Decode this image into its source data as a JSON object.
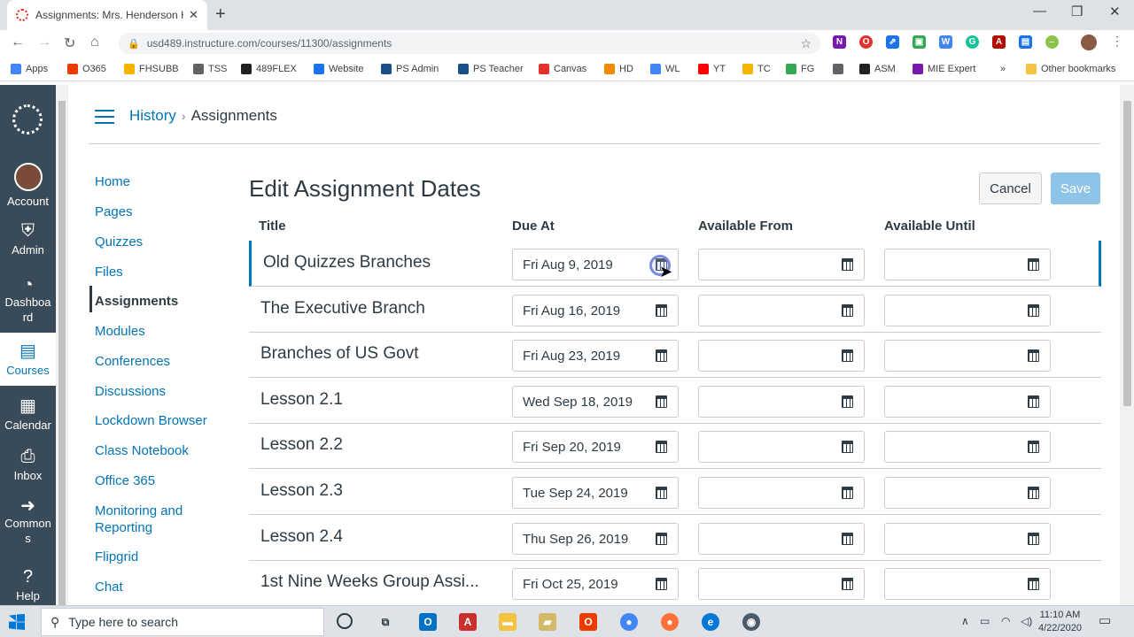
{
  "browser": {
    "tab_title": "Assignments: Mrs. Henderson Hi",
    "url": "usd489.instructure.com/courses/11300/assignments",
    "bookmarks": [
      {
        "label": "Apps",
        "color": "#4285f4"
      },
      {
        "label": "O365",
        "color": "#eb3c00"
      },
      {
        "label": "FHSUBB",
        "color": "#f4b400"
      },
      {
        "label": "TSS",
        "color": "#5f6368"
      },
      {
        "label": "489FLEX",
        "color": "#202124"
      },
      {
        "label": "Website",
        "color": "#1a73e8"
      },
      {
        "label": "PS Admin",
        "color": "#1b4f8a"
      },
      {
        "label": "PS Teacher",
        "color": "#1b4f8a"
      },
      {
        "label": "Canvas",
        "color": "#e3322b"
      },
      {
        "label": "HD",
        "color": "#f28b00"
      },
      {
        "label": "WL",
        "color": "#4285f4"
      },
      {
        "label": "YT",
        "color": "#ff0000"
      },
      {
        "label": "TC",
        "color": "#f4b400"
      },
      {
        "label": "FG",
        "color": "#34a853"
      },
      {
        "label": "",
        "color": "#5f6368"
      },
      {
        "label": "ASM",
        "color": "#202124"
      },
      {
        "label": "MIE Expert",
        "color": "#7719aa"
      }
    ],
    "more_bookmarks": "»",
    "other_bookmarks": "Other bookmarks"
  },
  "global_nav": [
    {
      "label": "Account",
      "icon": "avatar"
    },
    {
      "label": "Admin",
      "icon": "shield-icon"
    },
    {
      "label": "Dashboa rd",
      "icon": "dashboard-icon"
    },
    {
      "label": "Courses",
      "icon": "courses-icon"
    },
    {
      "label": "Calendar",
      "icon": "calendar-icon"
    },
    {
      "label": "Inbox",
      "icon": "inbox-icon"
    },
    {
      "label": "Common s",
      "icon": "commons-icon"
    },
    {
      "label": "Help",
      "icon": "help-icon"
    }
  ],
  "breadcrumb": {
    "course": "History",
    "page": "Assignments"
  },
  "course_nav": [
    "Home",
    "Pages",
    "Quizzes",
    "Files",
    "Assignments",
    "Modules",
    "Conferences",
    "Discussions",
    "Lockdown Browser",
    "Class Notebook",
    "Office 365",
    "Monitoring and Reporting",
    "Flipgrid",
    "Chat"
  ],
  "course_nav_active": "Assignments",
  "main": {
    "title": "Edit Assignment Dates",
    "cancel_label": "Cancel",
    "save_label": "Save",
    "columns": [
      "Title",
      "Due At",
      "Available From",
      "Available Until"
    ],
    "rows": [
      {
        "title": "Old Quizzes Branches",
        "due": "Fri Aug 9, 2019",
        "from": "",
        "until": ""
      },
      {
        "title": "The Executive Branch",
        "due": "Fri Aug 16, 2019",
        "from": "",
        "until": ""
      },
      {
        "title": "Branches of US Govt",
        "due": "Fri Aug 23, 2019",
        "from": "",
        "until": ""
      },
      {
        "title": "Lesson 2.1",
        "due": "Wed Sep 18, 2019",
        "from": "",
        "until": ""
      },
      {
        "title": "Lesson 2.2",
        "due": "Fri Sep 20, 2019",
        "from": "",
        "until": ""
      },
      {
        "title": "Lesson 2.3",
        "due": "Tue Sep 24, 2019",
        "from": "",
        "until": ""
      },
      {
        "title": "Lesson 2.4",
        "due": "Thu Sep 26, 2019",
        "from": "",
        "until": ""
      },
      {
        "title": "1st Nine Weeks Group Assi...",
        "due": "Fri Oct 25, 2019",
        "from": "",
        "until": ""
      }
    ]
  },
  "taskbar": {
    "search_placeholder": "Type here to search",
    "time": "11:10 AM",
    "date": "4/22/2020"
  }
}
